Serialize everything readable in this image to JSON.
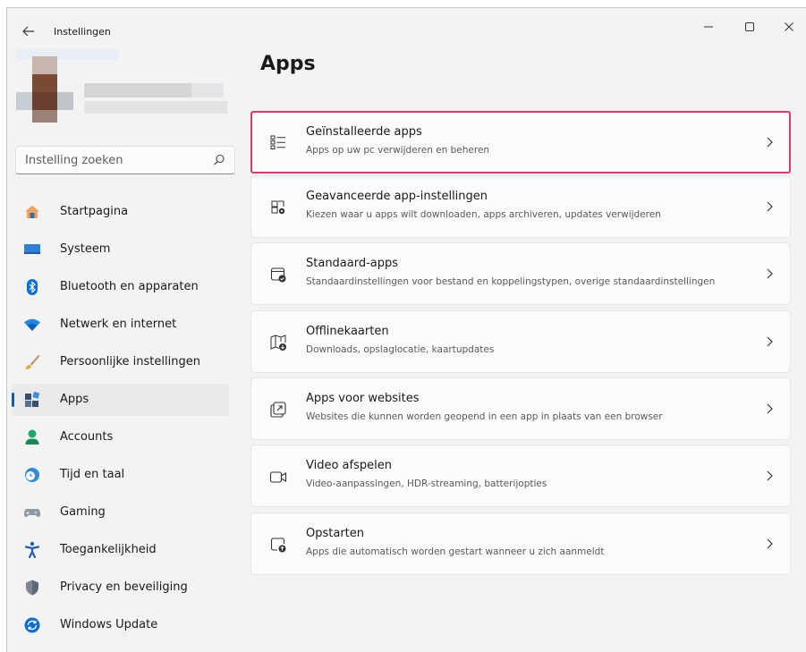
{
  "window": {
    "title": "Instellingen",
    "back_icon": "arrow-left-icon",
    "controls": [
      "minimize-icon",
      "maximize-icon",
      "close-icon"
    ]
  },
  "search": {
    "placeholder": "Instelling zoeken",
    "icon": "search-icon"
  },
  "sidebar": {
    "items": [
      {
        "label": "Startpagina",
        "icon": "home-icon",
        "active": false
      },
      {
        "label": "Systeem",
        "icon": "monitor-icon",
        "active": false
      },
      {
        "label": "Bluetooth en apparaten",
        "icon": "bluetooth-icon",
        "active": false
      },
      {
        "label": "Netwerk en internet",
        "icon": "wifi-icon",
        "active": false
      },
      {
        "label": "Persoonlijke instellingen",
        "icon": "brush-icon",
        "active": false
      },
      {
        "label": "Apps",
        "icon": "apps-icon",
        "active": true
      },
      {
        "label": "Accounts",
        "icon": "person-icon",
        "active": false
      },
      {
        "label": "Tijd en taal",
        "icon": "clock-globe-icon",
        "active": false
      },
      {
        "label": "Gaming",
        "icon": "gamepad-icon",
        "active": false
      },
      {
        "label": "Toegankelijkheid",
        "icon": "accessibility-icon",
        "active": false
      },
      {
        "label": "Privacy en beveiliging",
        "icon": "shield-icon",
        "active": false
      },
      {
        "label": "Windows Update",
        "icon": "update-icon",
        "active": false
      }
    ]
  },
  "main": {
    "title": "Apps",
    "cards": [
      {
        "title": "Geïnstalleerde apps",
        "subtitle": "Apps op uw pc verwijderen en beheren",
        "icon": "list-icon",
        "highlighted": true
      },
      {
        "title": "Geavanceerde app-instellingen",
        "subtitle": "Kiezen waar u apps wilt downloaden, apps archiveren, updates verwijderen",
        "icon": "app-settings-icon",
        "highlighted": false
      },
      {
        "title": "Standaard-apps",
        "subtitle": "Standaardinstellingen voor bestand en koppelingstypen, overige standaardinstellingen",
        "icon": "default-apps-icon",
        "highlighted": false
      },
      {
        "title": "Offlinekaarten",
        "subtitle": "Downloads, opslaglocatie, kaartupdates",
        "icon": "map-download-icon",
        "highlighted": false
      },
      {
        "title": "Apps voor websites",
        "subtitle": "Websites die kunnen worden geopend in een app in plaats van een browser",
        "icon": "open-in-app-icon",
        "highlighted": false
      },
      {
        "title": "Video afspelen",
        "subtitle": "Video-aanpassingen, HDR-streaming, batterijopties",
        "icon": "video-icon",
        "highlighted": false
      },
      {
        "title": "Opstarten",
        "subtitle": "Apps die automatisch worden gestart wanneer u zich aanmeldt",
        "icon": "startup-icon",
        "highlighted": false
      }
    ]
  },
  "colors": {
    "accent": "#005fb8",
    "highlight_border": "#e8336b",
    "window_bg": "#f3f3f3",
    "card_bg": "#fbfbfb"
  }
}
